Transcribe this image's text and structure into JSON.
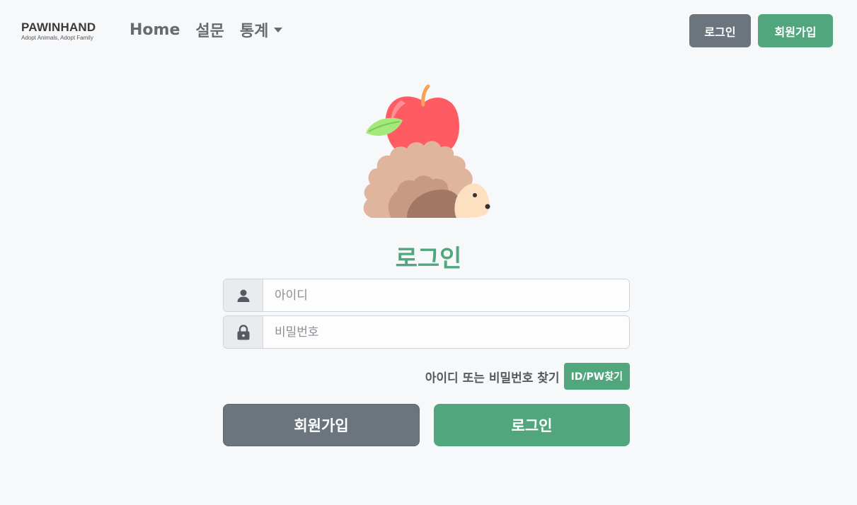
{
  "brand": {
    "name": "PAWINHAND",
    "tagline": "Adopt Animals, Adopt Family"
  },
  "nav": {
    "home": "Home",
    "survey": "설문",
    "stats": "통계"
  },
  "header_buttons": {
    "login": "로그인",
    "signup": "회원가입"
  },
  "page": {
    "title": "로그인"
  },
  "form": {
    "id_placeholder": "아이디",
    "pw_placeholder": "비밀번호",
    "find_text": "아이디 또는 비밀번호 찾기",
    "find_button": "ID/PW찾기",
    "signup_button": "회원가입",
    "login_button": "로그인"
  },
  "icons": {
    "user": "user-icon",
    "lock": "lock-icon",
    "caret": "caret-down-icon",
    "hero": "hedgehog-apple-illustration"
  },
  "colors": {
    "accent": "#52a67d",
    "secondary": "#6c757d",
    "background": "#f7f8fa"
  }
}
